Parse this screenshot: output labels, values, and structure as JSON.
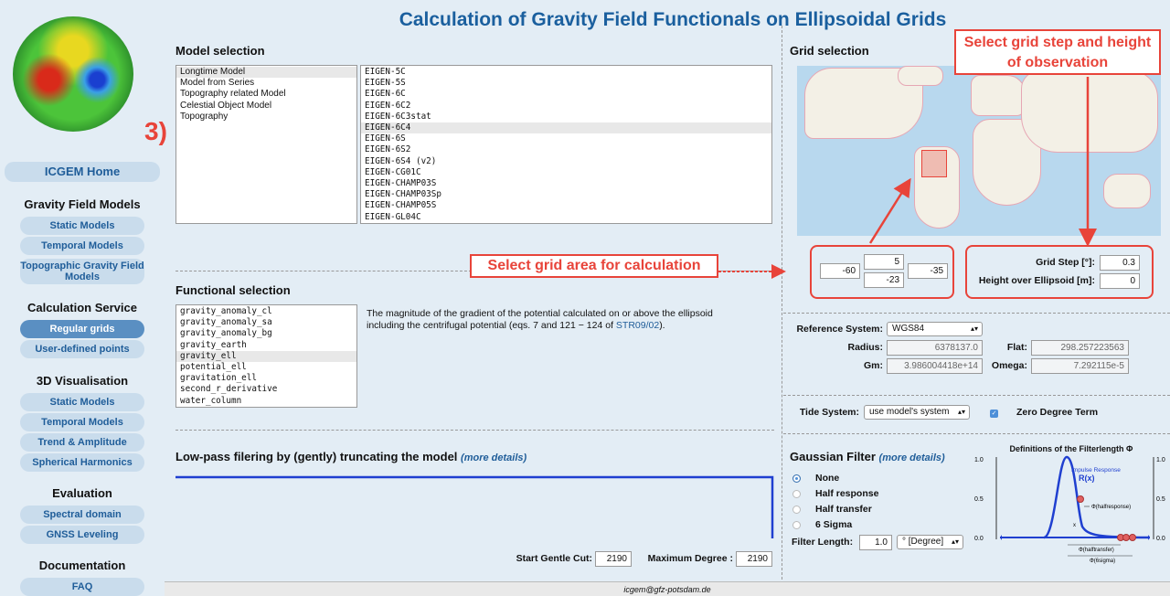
{
  "page": {
    "title": "Calculation of Gravity Field Functionals on Ellipsoidal Grids",
    "step_marker": "3)"
  },
  "sidebar": {
    "home": "ICGEM Home",
    "sections": [
      {
        "heading": "Gravity Field Models",
        "items": [
          "Static Models",
          "Temporal Models",
          "Topographic Gravity Field Models"
        ]
      },
      {
        "heading": "Calculation Service",
        "items": [
          "Regular grids",
          "User-defined points"
        ],
        "active": "Regular grids"
      },
      {
        "heading": "3D Visualisation",
        "items": [
          "Static Models",
          "Temporal Models",
          "Trend & Amplitude",
          "Spherical Harmonics"
        ]
      },
      {
        "heading": "Evaluation",
        "items": [
          "Spectral domain",
          "GNSS Leveling"
        ]
      },
      {
        "heading": "Documentation",
        "items": [
          "FAQ"
        ]
      }
    ]
  },
  "model_selection": {
    "heading": "Model selection",
    "categories": [
      "Longtime Model",
      "Model from Series",
      "Topography related Model",
      "Celestial Object Model",
      "Topography"
    ],
    "selected_category": "Longtime Model",
    "models": [
      "EIGEN-5C",
      "EIGEN-5S",
      "EIGEN-6C",
      "EIGEN-6C2",
      "EIGEN-6C3stat",
      "EIGEN-6C4",
      "EIGEN-6S",
      "EIGEN-6S2",
      "EIGEN-6S4 (v2)",
      "EIGEN-CG01C",
      "EIGEN-CHAMP03S",
      "EIGEN-CHAMP03Sp",
      "EIGEN-CHAMP05S",
      "EIGEN-GL04C"
    ],
    "selected_model": "EIGEN-6C4"
  },
  "functional_selection": {
    "heading": "Functional selection",
    "items": [
      "gravity_anomaly_cl",
      "gravity_anomaly_sa",
      "gravity_anomaly_bg",
      "gravity_earth",
      "gravity_ell",
      "potential_ell",
      "gravitation_ell",
      "second_r_derivative",
      "water_column"
    ],
    "selected": "gravity_ell",
    "description": "The magnitude of the gradient of the potential calculated on or above the ellipsoid including the centrifugal potential (eqs. 7 and 121 − 124 of ",
    "description_link": "STR09/02",
    "description_end": ")."
  },
  "lowpass": {
    "heading": "Low-pass filering by (gently) truncating the model",
    "more": "(more details)",
    "start_label": "Start Gentle Cut:",
    "start_value": "2190",
    "max_label": "Maximum Degree :",
    "max_value": "2190"
  },
  "grid": {
    "heading": "Grid selection",
    "north": "5",
    "west": "-60",
    "east": "-35",
    "south": "-23",
    "step_label": "Grid Step [°]:",
    "step_value": "0.3",
    "height_label": "Height over Ellipsoid [m]:",
    "height_value": "0"
  },
  "callouts": {
    "grid_step": "Select grid step and height of observation",
    "grid_area": "Select grid area for calculation"
  },
  "reference": {
    "system_label": "Reference System:",
    "system_value": "WGS84",
    "radius_label": "Radius:",
    "radius_value": "6378137.0",
    "flat_label": "Flat:",
    "flat_value": "298.257223563",
    "gm_label": "Gm:",
    "gm_value": "3.986004418e+14",
    "omega_label": "Omega:",
    "omega_value": "7.292115e-5"
  },
  "tide": {
    "label": "Tide System:",
    "value": "use model's system",
    "zero_degree": "Zero Degree Term",
    "zero_checked": true
  },
  "gaussian": {
    "heading": "Gaussian Filter",
    "more": "(more details)",
    "options": [
      "None",
      "Half response",
      "Half transfer",
      "6 Sigma"
    ],
    "selected": "None",
    "length_label": "Filter Length:",
    "length_value": "1.0",
    "unit": "° [Degree]"
  },
  "filter_plot": {
    "title": "Definitions of the Filterlength Φ",
    "yticks": [
      "1.0",
      "0.5",
      "0.0"
    ],
    "impulse": "Impulse Response",
    "rx": "R(x)",
    "halfresponse": "Φ(halfresponse)",
    "halftransfer": "Φ(halftransfer)",
    "sixsigma": "Φ(6sigma)",
    "x": "x"
  },
  "footer": {
    "email": "icgem@gfz-potsdam.de"
  },
  "colors": {
    "accent": "#1a5f9e",
    "callout": "#e8443a",
    "nav": "#c9dcec",
    "nav_active": "#5a8fc2"
  }
}
